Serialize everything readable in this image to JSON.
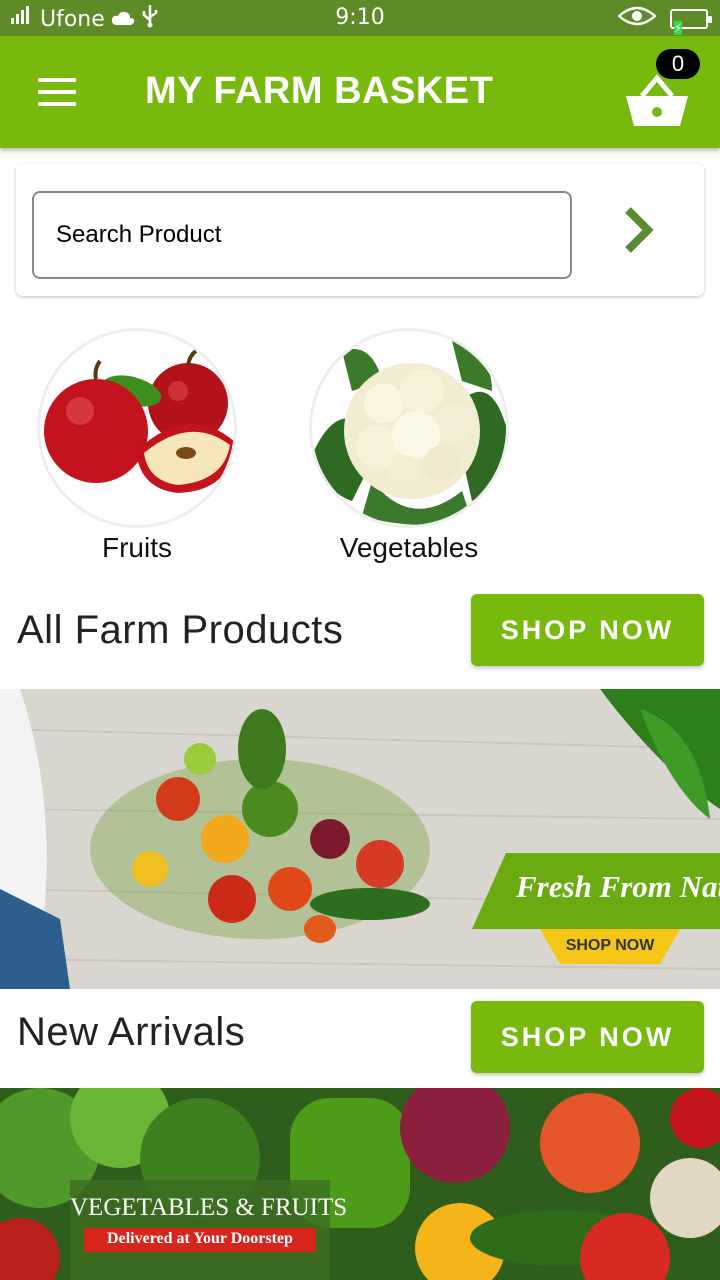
{
  "status_bar": {
    "carrier": "Ufone",
    "time": "9:10"
  },
  "app_bar": {
    "title": "MY FARM BASKET",
    "cart_count": "0"
  },
  "search": {
    "placeholder": "Search Product"
  },
  "categories": [
    {
      "label": "Fruits",
      "icon": "apple-image"
    },
    {
      "label": "Vegetables",
      "icon": "cauliflower-image"
    }
  ],
  "sections": {
    "all_products": {
      "title": "All Farm Products",
      "button": "SHOP NOW"
    },
    "new_arrivals": {
      "title": "New Arrivals",
      "button": "SHOP NOW"
    }
  },
  "banners": {
    "fresh": {
      "headline": "Fresh From Nature",
      "cta": "SHOP NOW"
    },
    "veg_fruits": {
      "headline": "VEGETABLES & FRUITS",
      "tagline": "Delivered at Your Doorstep"
    }
  },
  "colors": {
    "brand_green": "#77b90c",
    "status_bar": "#5e8a28"
  }
}
